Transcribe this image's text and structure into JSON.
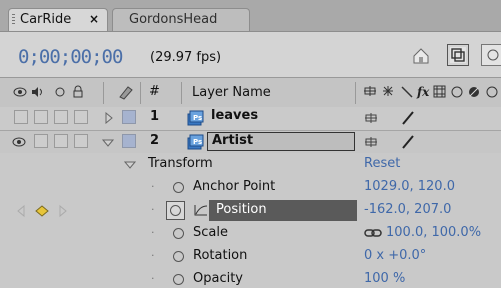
{
  "tabs": [
    {
      "label": "CarRide",
      "close": "×",
      "active": true
    },
    {
      "label": "GordonsHead",
      "active": false
    }
  ],
  "header": {
    "timecode": "0;00;00;00",
    "fps": "(29.97 fps)"
  },
  "columns": {
    "number": "#",
    "layer_name": "Layer Name"
  },
  "layers": [
    {
      "number": "1",
      "name": "leaves"
    },
    {
      "number": "2",
      "name": "Artist"
    }
  ],
  "transform": {
    "label": "Transform",
    "reset": "Reset",
    "properties": [
      {
        "label": "Anchor Point",
        "value": "1029.0, 120.0"
      },
      {
        "label": "Position",
        "value": "-162.0, 207.0"
      },
      {
        "label": "Scale",
        "value": "100.0, 100.0%"
      },
      {
        "label": "Rotation",
        "value": "0 x +0.0°"
      },
      {
        "label": "Opacity",
        "value": "100 %"
      }
    ]
  },
  "colors": {
    "accent_blue": "#3f68a9",
    "selected_bg": "#5a5a5a",
    "keyframe": "#e7c53a"
  }
}
